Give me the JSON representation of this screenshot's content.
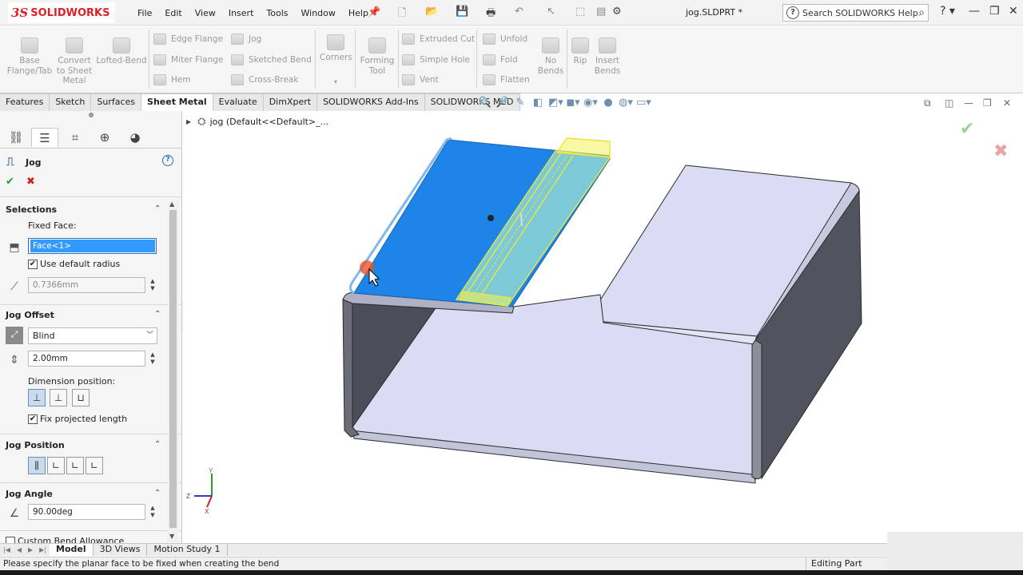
{
  "app": {
    "logo_ds": "3S",
    "logo_text": "SOLIDWORKS",
    "doc_title": "jog.SLDPRT *",
    "search_placeholder": "Search SOLIDWORKS Help"
  },
  "menu": [
    "File",
    "Edit",
    "View",
    "Insert",
    "Tools",
    "Window",
    "Help"
  ],
  "command_manager": {
    "big": [
      {
        "label": "Base\nFlange/Tab"
      },
      {
        "label": "Convert\nto Sheet\nMetal"
      },
      {
        "label": "Lofted-Bend"
      },
      {
        "label": "Corners"
      },
      {
        "label": "Forming\nTool"
      },
      {
        "label": "No\nBends"
      },
      {
        "label": "Rip"
      },
      {
        "label": "Insert\nBends"
      }
    ],
    "small": [
      "Edge Flange",
      "Miter Flange",
      "Hem",
      "Jog",
      "Sketched Bend",
      "Cross-Break",
      "Extruded Cut",
      "Simple Hole",
      "Vent",
      "Unfold",
      "Fold",
      "Flatten"
    ]
  },
  "tabs": [
    "Features",
    "Sketch",
    "Surfaces",
    "Sheet Metal",
    "Evaluate",
    "DimXpert",
    "SOLIDWORKS Add-Ins",
    "SOLIDWORKS MBD"
  ],
  "property_manager": {
    "title": "Jog",
    "help": "?",
    "ok": "✔",
    "cancel": "✖",
    "selections": {
      "header": "Selections",
      "fixed_face_label": "Fixed Face:",
      "fixed_face_value": "Face<1>",
      "use_default_radius": "Use default radius",
      "radius_value": "0.7366mm"
    },
    "jog_offset": {
      "header": "Jog Offset",
      "end_condition": "Blind",
      "offset_value": "2.00mm",
      "dimension_position_label": "Dimension position:",
      "fix_projected_length": "Fix projected length"
    },
    "jog_position": {
      "header": "Jog Position"
    },
    "jog_angle": {
      "header": "Jog Angle",
      "angle_value": "90.00deg"
    },
    "custom_bend_allowance": "Custom Bend Allowance"
  },
  "viewport": {
    "tree_flyout": "jog  (Default<<Default>_...",
    "triad": {
      "x": "X",
      "y": "Y",
      "z": "Z"
    }
  },
  "bottom_tabs": [
    "Model",
    "3D Views",
    "Motion Study 1"
  ],
  "status": {
    "message": "Please specify the planar face to be fixed when creating the bend",
    "mode": "Editing Part"
  },
  "colors": {
    "brand_red": "#da2128",
    "selected_face": "#1f84e8",
    "preview_yellow": "#f2f23a",
    "part_face": "#d9dcf3"
  }
}
